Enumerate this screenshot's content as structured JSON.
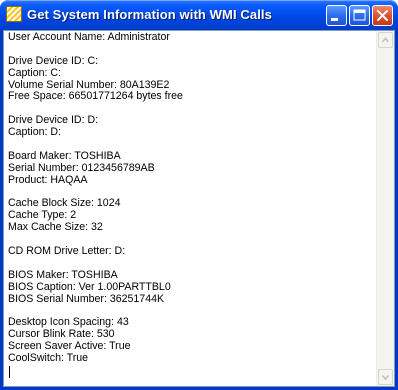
{
  "window": {
    "title": "Get System Information with WMI Calls",
    "app_icon": "striped-app-icon",
    "controls": {
      "minimize_icon": "minimize-icon",
      "maximize_icon": "maximize-icon",
      "close_icon": "close-icon"
    }
  },
  "colors": {
    "titlebar": "#0a5bff",
    "close_button": "#df5334",
    "text_background": "#ffffff",
    "text_color": "#000000"
  },
  "output_lines": [
    "User Account Name: Administrator",
    "",
    "Drive Device ID: C:",
    "Caption: C:",
    "Volume Serial Number: 80A139E2",
    "Free Space: 66501771264 bytes free",
    "",
    "Drive Device ID: D:",
    "Caption: D:",
    "",
    "Board Maker: TOSHIBA",
    "Serial Number: 0123456789AB",
    "Product: HAQAA",
    "",
    "Cache Block Size: 1024",
    "Cache Type: 2",
    "Max Cache Size: 32",
    "",
    "CD ROM Drive Letter: D:",
    "",
    "BIOS Maker: TOSHIBA",
    "BIOS Caption: Ver 1.00PARTTBL0",
    "BIOS Serial Number: 36251744K",
    "",
    "Desktop Icon Spacing: 43",
    "Cursor Blink Rate: 530",
    "Screen Saver Active: True",
    "CoolSwitch: True"
  ],
  "scrollbar": {
    "up_icon": "scroll-up-arrow-icon",
    "down_icon": "scroll-down-arrow-icon"
  }
}
